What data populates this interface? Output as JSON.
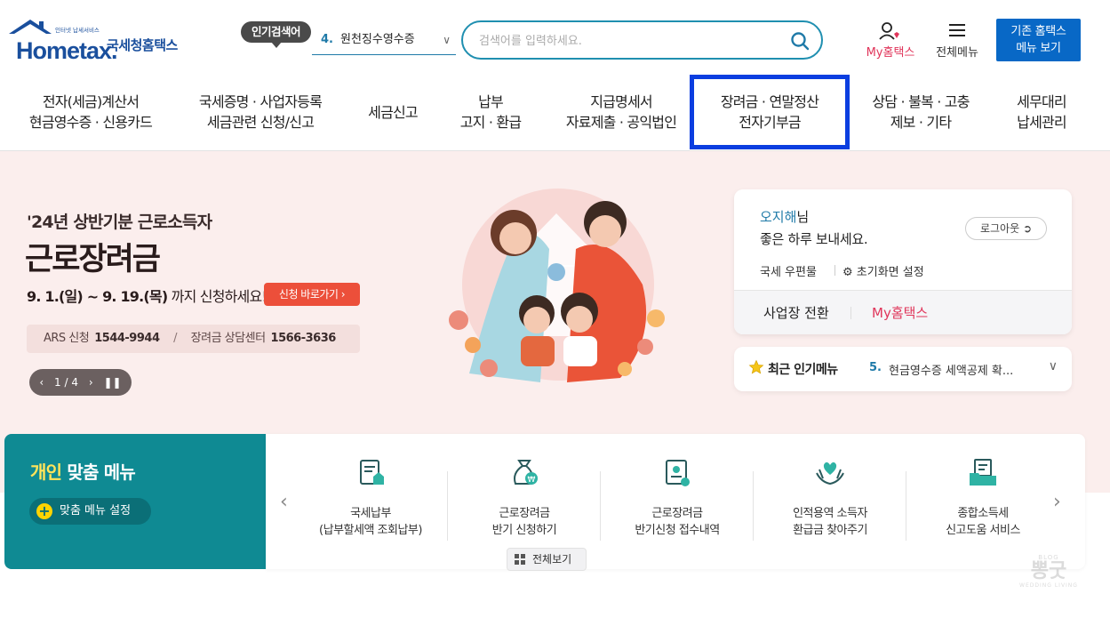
{
  "header": {
    "logo_small": "인터넷 납세서비스",
    "logo_word": "Hometax.",
    "logo_name": "국세청홈택스",
    "popular_badge": "인기검색어",
    "popular_num": "4.",
    "popular_value": "원천징수영수증",
    "search_placeholder": "검색어를 입력하세요.",
    "my_hometax": "My홈택스",
    "all_menu": "전체메뉴",
    "old_menu_line1": "기존 홈택스",
    "old_menu_line2": "메뉴 보기"
  },
  "nav": [
    {
      "l1": "전자(세금)계산서",
      "l2": "현금영수증 · 신용카드"
    },
    {
      "l1": "국세증명 · 사업자등록",
      "l2": "세금관련 신청/신고"
    },
    {
      "l1": "세금신고",
      "l2": ""
    },
    {
      "l1": "납부",
      "l2": "고지 · 환급"
    },
    {
      "l1": "지급명세서",
      "l2": "자료제출 · 공익법인"
    },
    {
      "l1": "장려금 · 연말정산",
      "l2": "전자기부금"
    },
    {
      "l1": "상담 · 불복 · 고충",
      "l2": "제보 · 기타"
    },
    {
      "l1": "세무대리",
      "l2": "납세관리"
    }
  ],
  "hero": {
    "subtitle": "'24년 상반기분 근로소득자",
    "title": "근로장려금",
    "period_bold": "9. 1.(일) ~ 9. 19.(목)",
    "period_rest": " 까지 신청하세요!",
    "apply_button": "신청 바로가기",
    "ars_label": "ARS 신청",
    "ars_number": "1544-9944",
    "center_label": "장려금 상담센터",
    "center_number": "1566-3636",
    "pager": "1 / 4"
  },
  "profile": {
    "name": "오지해",
    "honorific": "님",
    "greeting": "좋은 하루 보내세요.",
    "logout": "로그아웃",
    "mailbox": "국세 우편물",
    "init_setting": "초기화면 설정",
    "biz_switch": "사업장 전환",
    "my_link": "My홈택스"
  },
  "recent": {
    "title": "최근 인기메뉴",
    "num": "5.",
    "value": "현금영수증 세액공제 확..."
  },
  "personal_menu": {
    "title_hl": "개인",
    "title_rest": " 맞춤 메뉴",
    "setting": "맞춤 메뉴 설정",
    "all_view": "전체보기",
    "items": [
      {
        "l1": "국세납부",
        "l2": "(납부할세액 조회납부)",
        "icon": "tax-payment-icon"
      },
      {
        "l1": "근로장려금",
        "l2": "반기 신청하기",
        "icon": "money-bag-icon"
      },
      {
        "l1": "근로장려금",
        "l2": "반기신청 접수내역",
        "icon": "certificate-icon"
      },
      {
        "l1": "인적용역 소득자",
        "l2": "환급금 찾아주기",
        "icon": "heart-hands-icon"
      },
      {
        "l1": "종합소득세",
        "l2": "신고도움 서비스",
        "icon": "folder-doc-icon"
      }
    ]
  },
  "watermark": {
    "top": "BLOG",
    "main": "뽕굿",
    "bottom": "WEDDING LIVING"
  },
  "colors": {
    "brand": "#1a4f9d",
    "accent": "#0868c6",
    "teal": "#0f8a93",
    "nav_highlight": "#0b3ee0",
    "pink": "#e0355a"
  }
}
